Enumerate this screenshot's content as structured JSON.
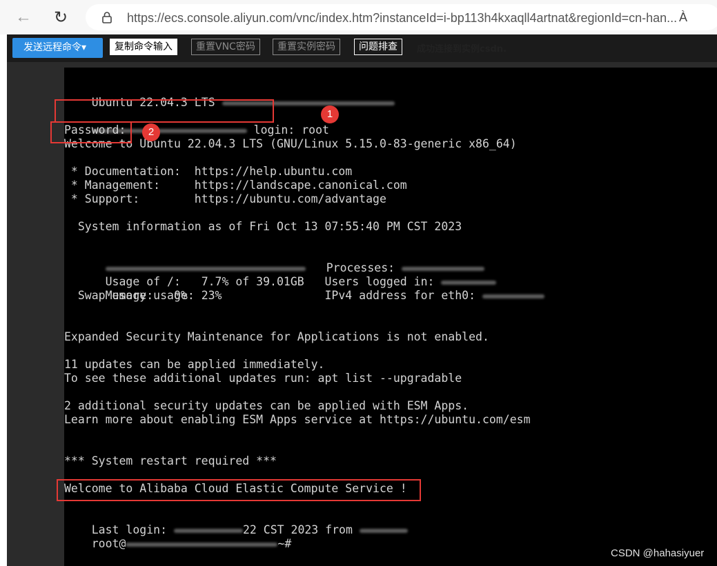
{
  "browser": {
    "url": "https://ecs.console.aliyun.com/vnc/index.htm?instanceId=i-bp113h4kxaqll4artnat&regionId=cn-han...",
    "read_aloud": "À"
  },
  "toolbar": {
    "send_remote_command": "发送远程命令▾",
    "copy_command_input": "复制命令输入",
    "reset_vnc_password": "重置VNC密码",
    "reset_instance_password": "重置实例密码",
    "troubleshoot": "问题排查",
    "status": "成功连接到实例csdn."
  },
  "terminal": {
    "lines": [
      "Ubuntu 22.04.3 LTS",
      " login: root",
      "Password:",
      "Welcome to Ubuntu 22.04.3 LTS (GNU/Linux 5.15.0-83-generic x86_64)",
      " * Documentation:  https://help.ubuntu.com",
      " * Management:     https://landscape.canonical.com",
      " * Support:        https://ubuntu.com/advantage",
      "  System information as of Fri Oct 13 07:55:40 PM CST 2023",
      "Processes:",
      "  Usage of /:   7.7% of 39.01GB   Users logged in:",
      "  Memory usage: 23%               IPv4 address for eth0:",
      "  Swap usage:   0%",
      "Expanded Security Maintenance for Applications is not enabled.",
      "11 updates can be applied immediately.",
      "To see these additional updates run: apt list --upgradable",
      "2 additional security updates can be applied with ESM Apps.",
      "Learn more about enabling ESM Apps service at https://ubuntu.com/esm",
      "*** System restart required ***",
      "Welcome to Alibaba Cloud Elastic Compute Service !",
      "Last login:",
      "22 CST 2023 from",
      "root@",
      "~#"
    ]
  },
  "annotations": {
    "step1": "1",
    "step2": "2"
  },
  "watermark": "CSDN @hahasiyuer",
  "colors": {
    "annotation_red": "#e53935",
    "toolbar_blue": "#2e8ee3",
    "terminal_bg": "#000000"
  }
}
